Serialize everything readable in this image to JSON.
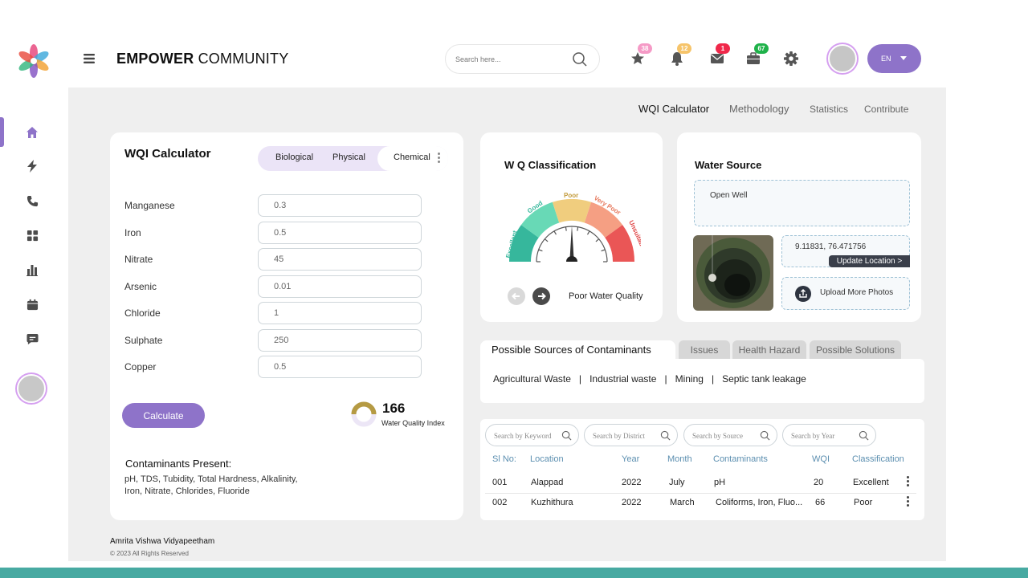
{
  "app": {
    "title_bold": "EMPOWER",
    "title_light": " COMMUNITY"
  },
  "search": {
    "placeholder": "Search here..."
  },
  "header": {
    "badges": {
      "favorites": "38",
      "notifications": "12",
      "messages": "1",
      "tasks": "67"
    },
    "language": "EN",
    "badge_colors": {
      "favorites": "#f59ac6",
      "notifications": "#f6c46a",
      "messages": "#f0284a",
      "tasks": "#1fb24a"
    }
  },
  "sidebar": {
    "items": [
      {
        "icon": "home-icon"
      },
      {
        "icon": "bolt-icon"
      },
      {
        "icon": "phone-icon"
      },
      {
        "icon": "grid-icon"
      },
      {
        "icon": "bar-chart-icon"
      },
      {
        "icon": "calendar-icon"
      },
      {
        "icon": "chat-icon"
      }
    ]
  },
  "page_tabs": [
    "WQI Calculator",
    "Methodology",
    "Statistics",
    "Contribute"
  ],
  "calculator": {
    "title": "WQI Calculator",
    "segments": [
      "Biological",
      "Physical",
      "Chemical"
    ],
    "active_segment": "Chemical",
    "params": [
      {
        "label": "Manganese",
        "value": "0.3"
      },
      {
        "label": "Iron",
        "value": "0.5"
      },
      {
        "label": "Nitrate",
        "value": "45"
      },
      {
        "label": "Arsenic",
        "value": "0.01"
      },
      {
        "label": "Chloride",
        "value": "1"
      },
      {
        "label": "Sulphate",
        "value": "250"
      },
      {
        "label": "Copper",
        "value": "0.5"
      }
    ],
    "button": "Calculate",
    "wqi_value": "166",
    "wqi_label": "Water Quality Index",
    "contaminants_title": "Contaminants Present:",
    "contaminants_line1": "pH, TDS, Tubidity, Total Hardness, Alkalinity,",
    "contaminants_line2": "Iron, Nitrate, Chlorides, Fluoride"
  },
  "classification": {
    "title": "W Q Classification",
    "levels": [
      "Excellent",
      "Good",
      "Poor",
      "Very Poor",
      "Unsuitable"
    ],
    "level_colors": [
      "#36b79c",
      "#68d9b6",
      "#f0cd7e",
      "#f59f83",
      "#ea5656"
    ],
    "status": "Poor Water Quality"
  },
  "water_source": {
    "title": "Water Source",
    "type": "Open Well",
    "coordinates": "9.11831, 76.471756",
    "update_location": "Update Location >",
    "upload": "Upload More Photos"
  },
  "sources_tabs": {
    "active": "Possible Sources of Contaminants",
    "others": [
      "Issues",
      "Health Hazard",
      "Possible Solutions"
    ],
    "items": [
      "Agricultural Waste",
      "Industrial waste",
      "Mining",
      "Septic tank leakage"
    ]
  },
  "filters": [
    "Search by Keyword",
    "Search by District",
    "Search by Source",
    "Search by Year"
  ],
  "table": {
    "headers": [
      "Sl No:",
      "Location",
      "Year",
      "Month",
      "Contaminants",
      "WQI",
      "Classification"
    ],
    "rows": [
      [
        "001",
        "Alappad",
        "2022",
        "July",
        "pH",
        "20",
        "Excellent"
      ],
      [
        "002",
        "Kuzhithura",
        "2022",
        "March",
        "Coliforms, Iron, Fluo...",
        "66",
        "Poor"
      ]
    ]
  },
  "footer": {
    "org": "Amrita Vishwa Vidyapeetham",
    "copyright": "© 2023 All Rights Reserved"
  }
}
